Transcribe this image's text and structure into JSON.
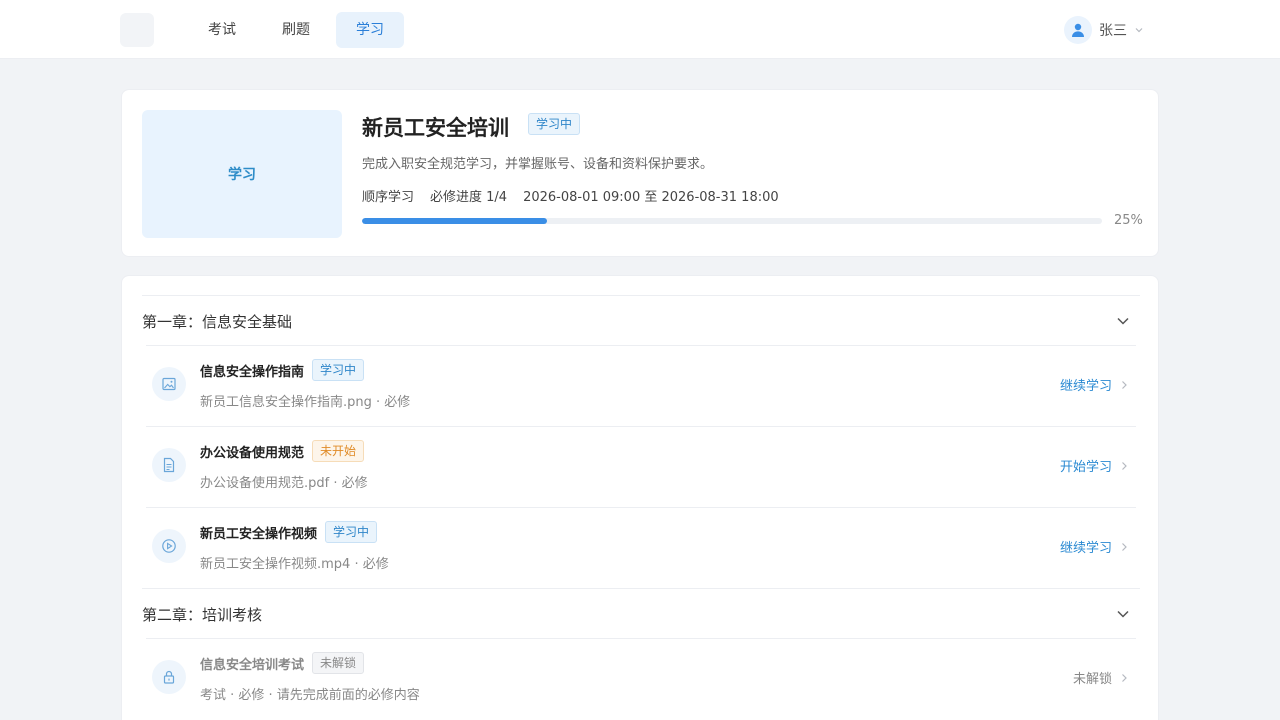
{
  "nav": {
    "tabs": [
      {
        "label": "考试"
      },
      {
        "label": "刷题"
      },
      {
        "label": "学习"
      }
    ],
    "user_name": "张三"
  },
  "course": {
    "cover_label": "学习",
    "title": "新员工安全培训",
    "status": "学习中",
    "description": "完成入职安全规范学习，并掌握账号、设备和资料保护要求。",
    "mode": "顺序学习",
    "required_progress": "必修进度 1/4",
    "period": "2026-08-01 09:00 至 2026-08-31 18:00",
    "progress": 25,
    "progress_text": "25%"
  },
  "chapters": [
    {
      "title": "第一章：信息安全基础",
      "items": [
        {
          "title": "信息安全操作指南",
          "status": "学习中",
          "sub": "新员工信息安全操作指南.png · 必修",
          "action": "继续学习",
          "icon": "image-icon"
        },
        {
          "title": "办公设备使用规范",
          "status": "未开始",
          "sub": "办公设备使用规范.pdf · 必修",
          "action": "开始学习",
          "icon": "document-icon"
        },
        {
          "title": "新员工安全操作视频",
          "status": "学习中",
          "sub": "新员工安全操作视频.mp4 · 必修",
          "action": "继续学习",
          "icon": "play-icon"
        }
      ]
    },
    {
      "title": "第二章：培训考核",
      "items": [
        {
          "title": "信息安全培训考试",
          "status": "未解锁",
          "sub": "考试 · 必修 · 请先完成前面的必修内容",
          "action": "未解锁",
          "icon": "lock-icon"
        }
      ]
    }
  ],
  "colors": {
    "accent": "#2b7fd8",
    "progress": "#3a8ee6",
    "learning": "#2f86c9",
    "not_started": "#e08b27",
    "locked": "#888888"
  }
}
